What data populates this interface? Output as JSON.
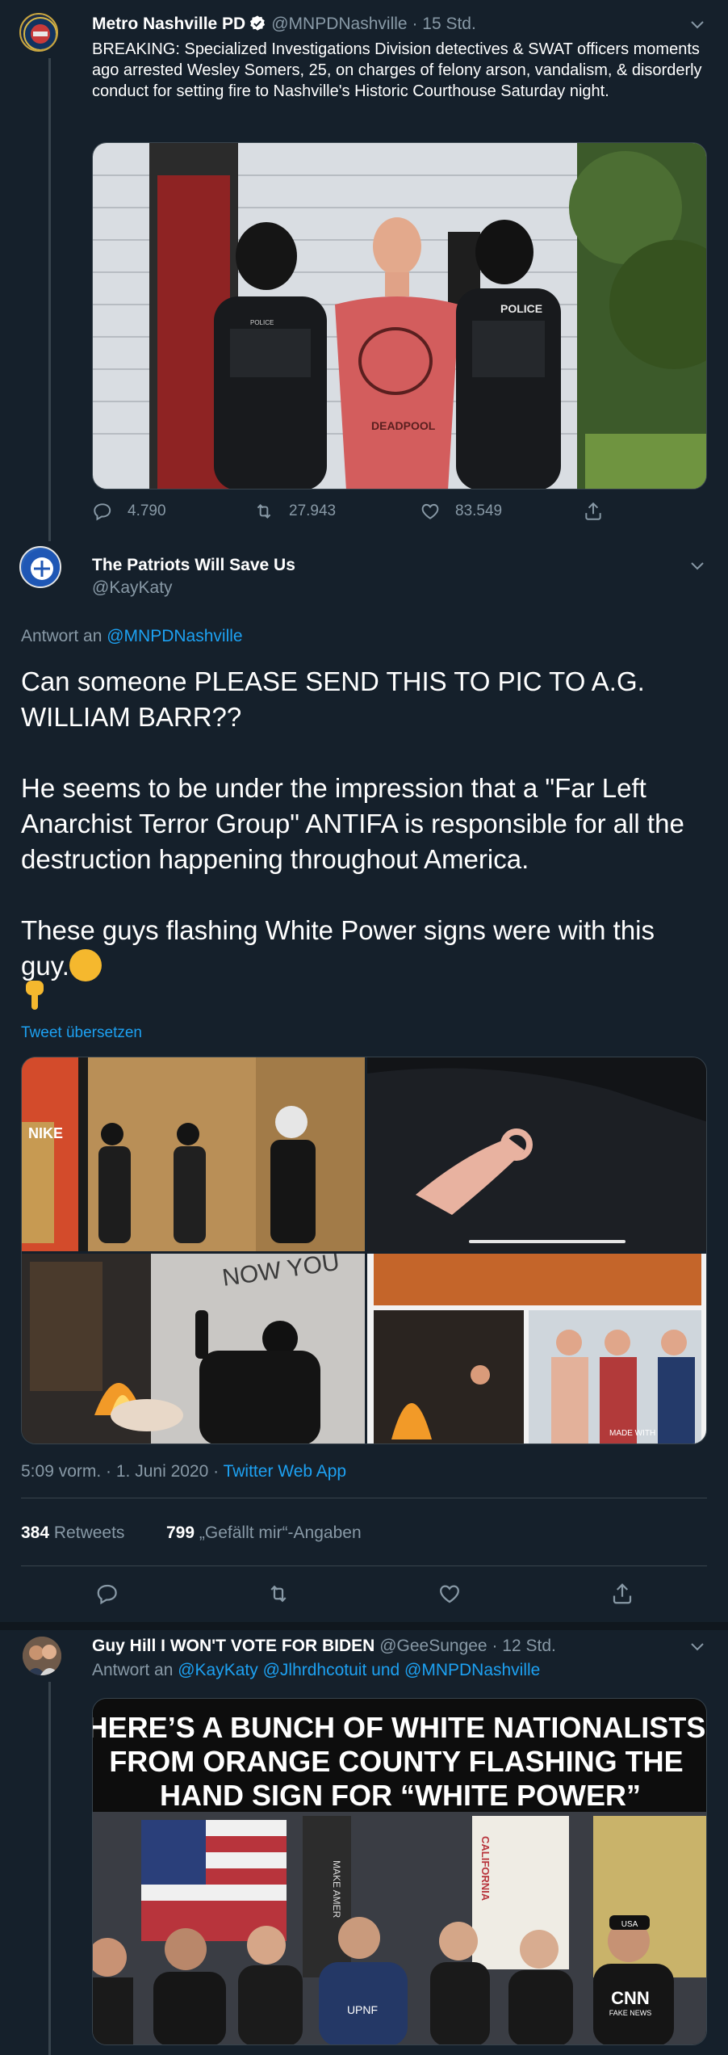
{
  "tweet1": {
    "display_name": "Metro Nashville PD",
    "handle": "@MNPDNashville",
    "time": "· 15 Std.",
    "avatar_text": "METRO POLICE",
    "text": "BREAKING: Specialized Investigations Division detectives & SWAT officers moments ago arrested Wesley Somers, 25, on charges of felony arson, vandalism, & disorderly conduct for setting fire to Nashville's Historic Courthouse Saturday night.",
    "photo_label_left": "POLICE",
    "photo_label_right": "POLICE",
    "photo_shirt": "DEADPOOL",
    "replies": "4.790",
    "retweets": "27.943",
    "likes": "83.549"
  },
  "tweet2": {
    "display_name": "The Patriots Will Save Us",
    "handle": "@KayKaty",
    "avatar_text": "VOTE BLUE",
    "reply_prefix": "Antwort an",
    "reply_to": "@MNPDNashville",
    "paragraphs": [
      "Can someone PLEASE SEND THIS TO PIC TO  A.G. WILLIAM BARR??",
      "He seems to be under the impression that a \"Far Left Anarchist Terror Group\" ANTIFA is responsible for all the destruction happening throughout America.",
      "These guys flashing White Power signs were  with this guy."
    ],
    "translate": "Tweet übersetzen",
    "grid_caption_nike": "NIKE",
    "grid_caption_wall": "NOW YOU",
    "grid_caption_watermark": "MADE WITH",
    "timestamp": "5:09 vorm. · 1. Juni 2020 ·",
    "source": "Twitter Web App",
    "retweet_count": "384",
    "retweet_label": "Retweets",
    "like_count": "799",
    "like_label": "„Gefällt mir“-Angaben"
  },
  "tweet3": {
    "display_name": "Guy Hill I WON'T VOTE FOR BIDEN",
    "handle": "@GeeSungee",
    "time": "· 12 Std.",
    "reply_prefix": "Antwort an",
    "reply_to": "@KayKaty @Jlhrdhcotuit und @MNPDNashville",
    "headline": "HERE’S A BUNCH OF WHITE NATIONALISTS FROM ORANGE COUNTY FLASHING THE HAND SIGN FOR “WHITE POWER”",
    "shirt_text": "UPNF",
    "flag_text": "CALIFORNIA",
    "banner_text": "MAKE AMER",
    "cnn_text": "CNN",
    "cnn_sub": "FAKE NEWS",
    "cap_text": "USA"
  },
  "colors": {
    "background": "#15202b",
    "muted": "#8899a6",
    "link": "#1da1f2",
    "divider": "#38444d"
  }
}
